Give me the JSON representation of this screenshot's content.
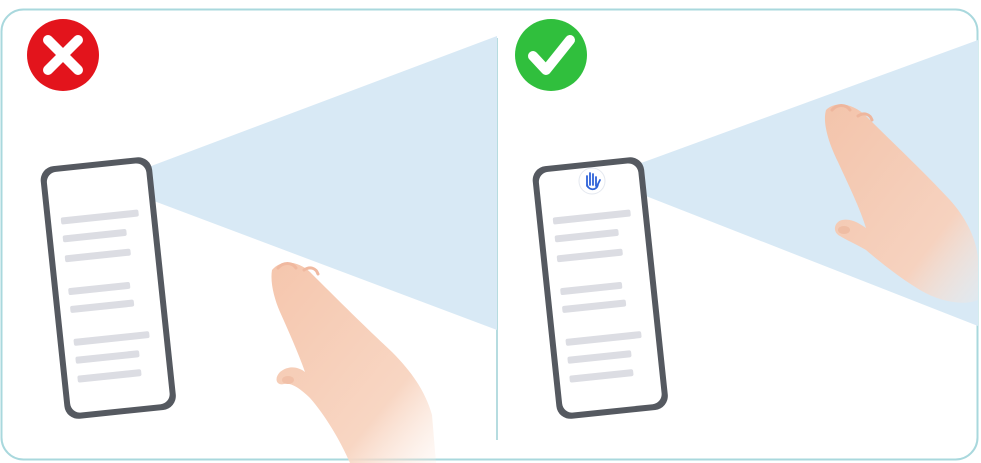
{
  "panels": [
    {
      "status": "incorrect",
      "badge_icon": "x-mark-icon",
      "badge_color": "#e3121b",
      "gesture_icon_visible": false,
      "hand_position": "below-sensing-area"
    },
    {
      "status": "correct",
      "badge_icon": "check-mark-icon",
      "badge_color": "#2ebd3b",
      "gesture_icon_visible": true,
      "gesture_icon": "hand-gesture-icon",
      "hand_position": "inside-sensing-area"
    }
  ],
  "colors": {
    "frame_border": "#9fd3d9",
    "sensing_area": "#d6e8f5",
    "phone_body": "#50545c",
    "screen": "#ffffff",
    "text_lines": "#dcdde2",
    "skin": "#f6cdb5",
    "gesture_icon": "#2f63d8"
  }
}
